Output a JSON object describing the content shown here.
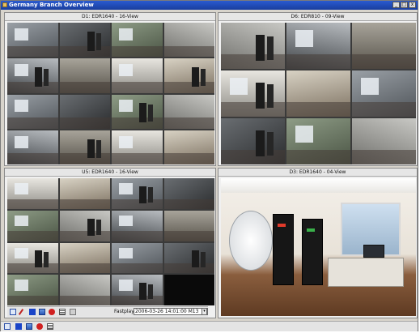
{
  "window": {
    "title": "Germany Branch Overview",
    "controls": [
      "_",
      "□",
      "x"
    ]
  },
  "panels": [
    {
      "id": "d1",
      "title": "D1: EDR1640 - 16-View",
      "rows": 4,
      "cols": 4
    },
    {
      "id": "d6",
      "title": "D6: EDR810 - 09-View",
      "rows": 3,
      "cols": 3
    },
    {
      "id": "u5",
      "title": "U5: EDR1640 - 16-View",
      "rows": 4,
      "cols": 4
    },
    {
      "id": "d3",
      "title": "D3: EDR1640 - 04-View"
    }
  ],
  "playback": {
    "mode_label": "Fastplay",
    "datetime": "2006-03-26 14:01:00  M13",
    "dropdown_icon": "chevron-down-icon"
  },
  "toolbar_icons": [
    "export-icon",
    "pen-icon",
    "stop-icon",
    "save-icon",
    "record-icon",
    "list-icon",
    "zoom-icon"
  ],
  "statusbar_icons": [
    "export-icon",
    "stop-icon",
    "save-icon",
    "record-icon",
    "list-icon"
  ],
  "colors": {
    "titlebar": "#2a5bd0",
    "record": "#d02020",
    "stop": "#1a44c8"
  }
}
